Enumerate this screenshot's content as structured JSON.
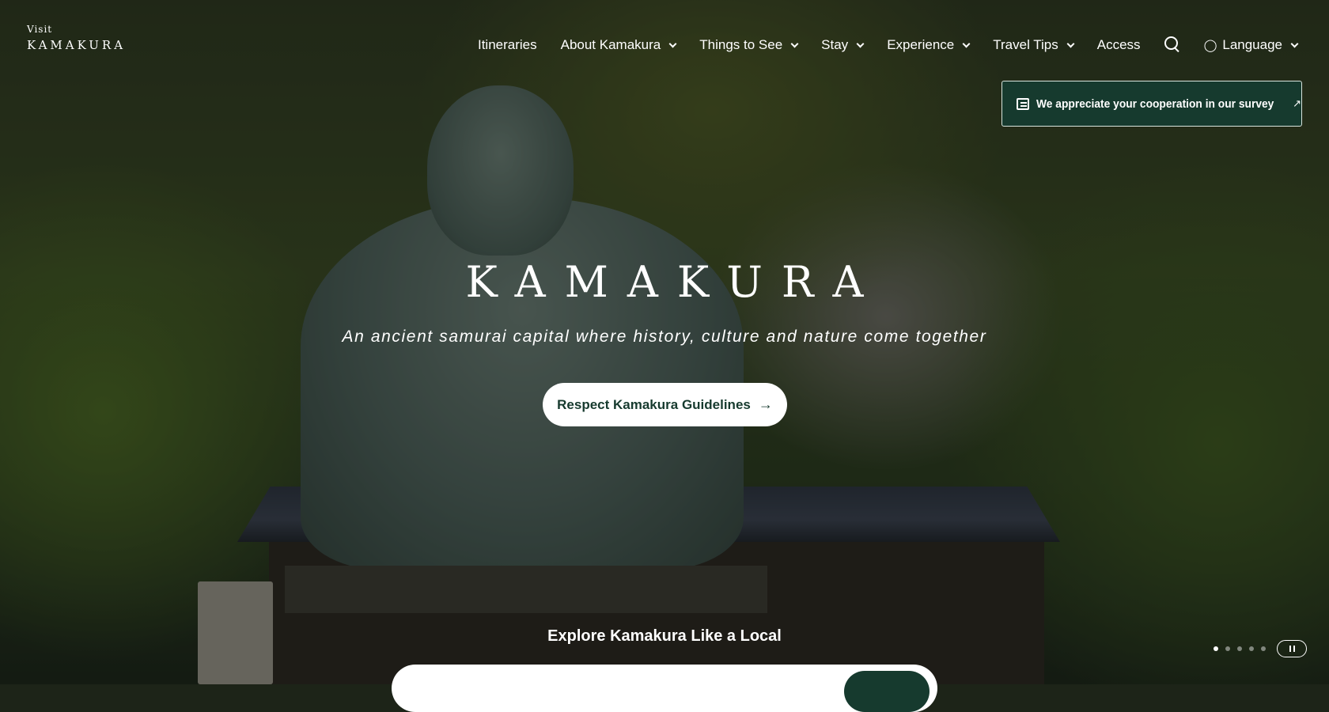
{
  "logo": {
    "visit": "Visit",
    "name": "KAMAKURA"
  },
  "nav": {
    "items": [
      {
        "label": "Itineraries",
        "has_dropdown": false
      },
      {
        "label": "About Kamakura",
        "has_dropdown": true
      },
      {
        "label": "Things to See",
        "has_dropdown": true
      },
      {
        "label": "Stay",
        "has_dropdown": true
      },
      {
        "label": "Experience",
        "has_dropdown": true
      },
      {
        "label": "Travel Tips",
        "has_dropdown": true
      },
      {
        "label": "Access",
        "has_dropdown": false
      }
    ],
    "search_icon": "search-icon",
    "language": {
      "label": "Language",
      "icon": "globe-icon"
    }
  },
  "survey": {
    "text": "We appreciate your cooperation in our survey",
    "icon": "chat-icon",
    "external_icon": "external-link-icon"
  },
  "hero": {
    "title": "KAMAKURA",
    "tagline": "An ancient samurai capital where history, culture and nature come together",
    "cta_label": "Respect Kamakura Guidelines"
  },
  "explore": {
    "heading": "Explore Kamakura Like a Local"
  },
  "slider": {
    "slide_count": 5,
    "active_index": 0,
    "pause_icon": "pause-icon"
  },
  "colors": {
    "brand_green": "#163a2e",
    "white": "#ffffff"
  }
}
